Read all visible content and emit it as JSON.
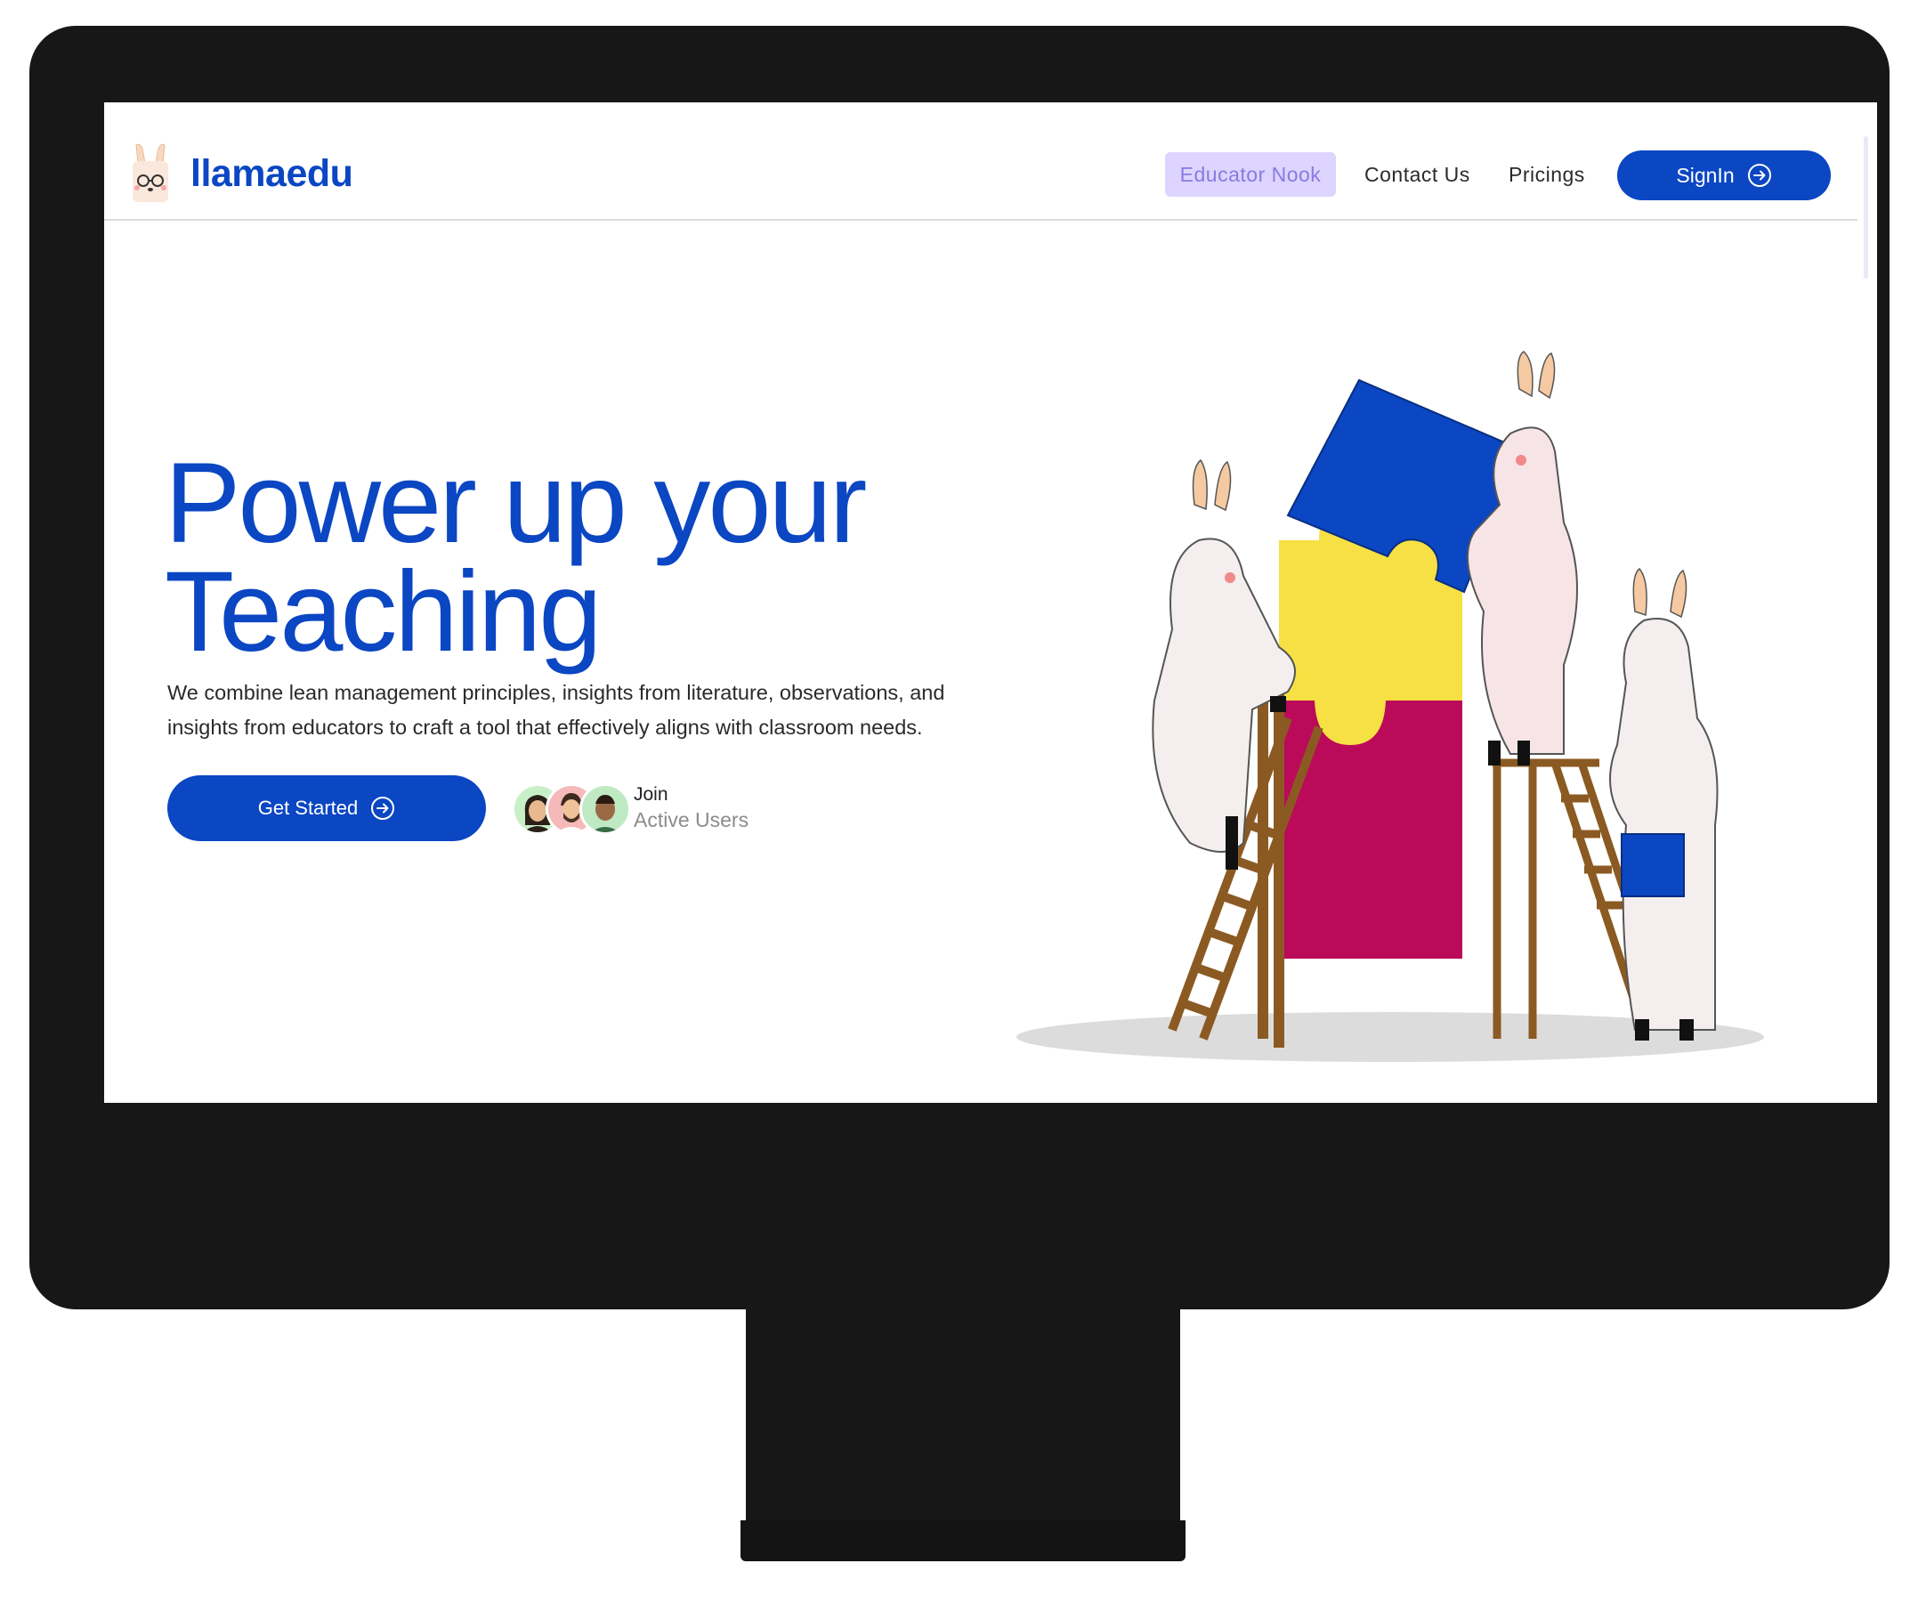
{
  "brand": {
    "name": "llamaedu"
  },
  "nav": {
    "items": [
      {
        "label": "Educator Nook",
        "active": true
      },
      {
        "label": "Contact Us"
      },
      {
        "label": "Pricings"
      }
    ],
    "signin_label": "SignIn"
  },
  "hero": {
    "headline_line1": "Power up your",
    "headline_line2": "Teaching",
    "description": "We combine lean management principles, insights from literature, observations, and insights from educators to craft a tool that effectively aligns with classroom needs.",
    "cta_label": "Get Started",
    "join_label": "Join",
    "active_label": "Active Users"
  },
  "colors": {
    "primary": "#0b46c3",
    "nav_active_bg": "#ddd4ff",
    "nav_active_text": "#8a7ae0",
    "puzzle_blue": "#0b46c3",
    "puzzle_yellow": "#f6e044",
    "puzzle_magenta": "#bb0a5a",
    "ladder": "#8b5a22",
    "monitor_frame": "#171717"
  },
  "icons": {
    "logo": "llama-face-icon",
    "signin": "arrow-right-circle-icon",
    "cta": "arrow-right-circle-icon"
  }
}
